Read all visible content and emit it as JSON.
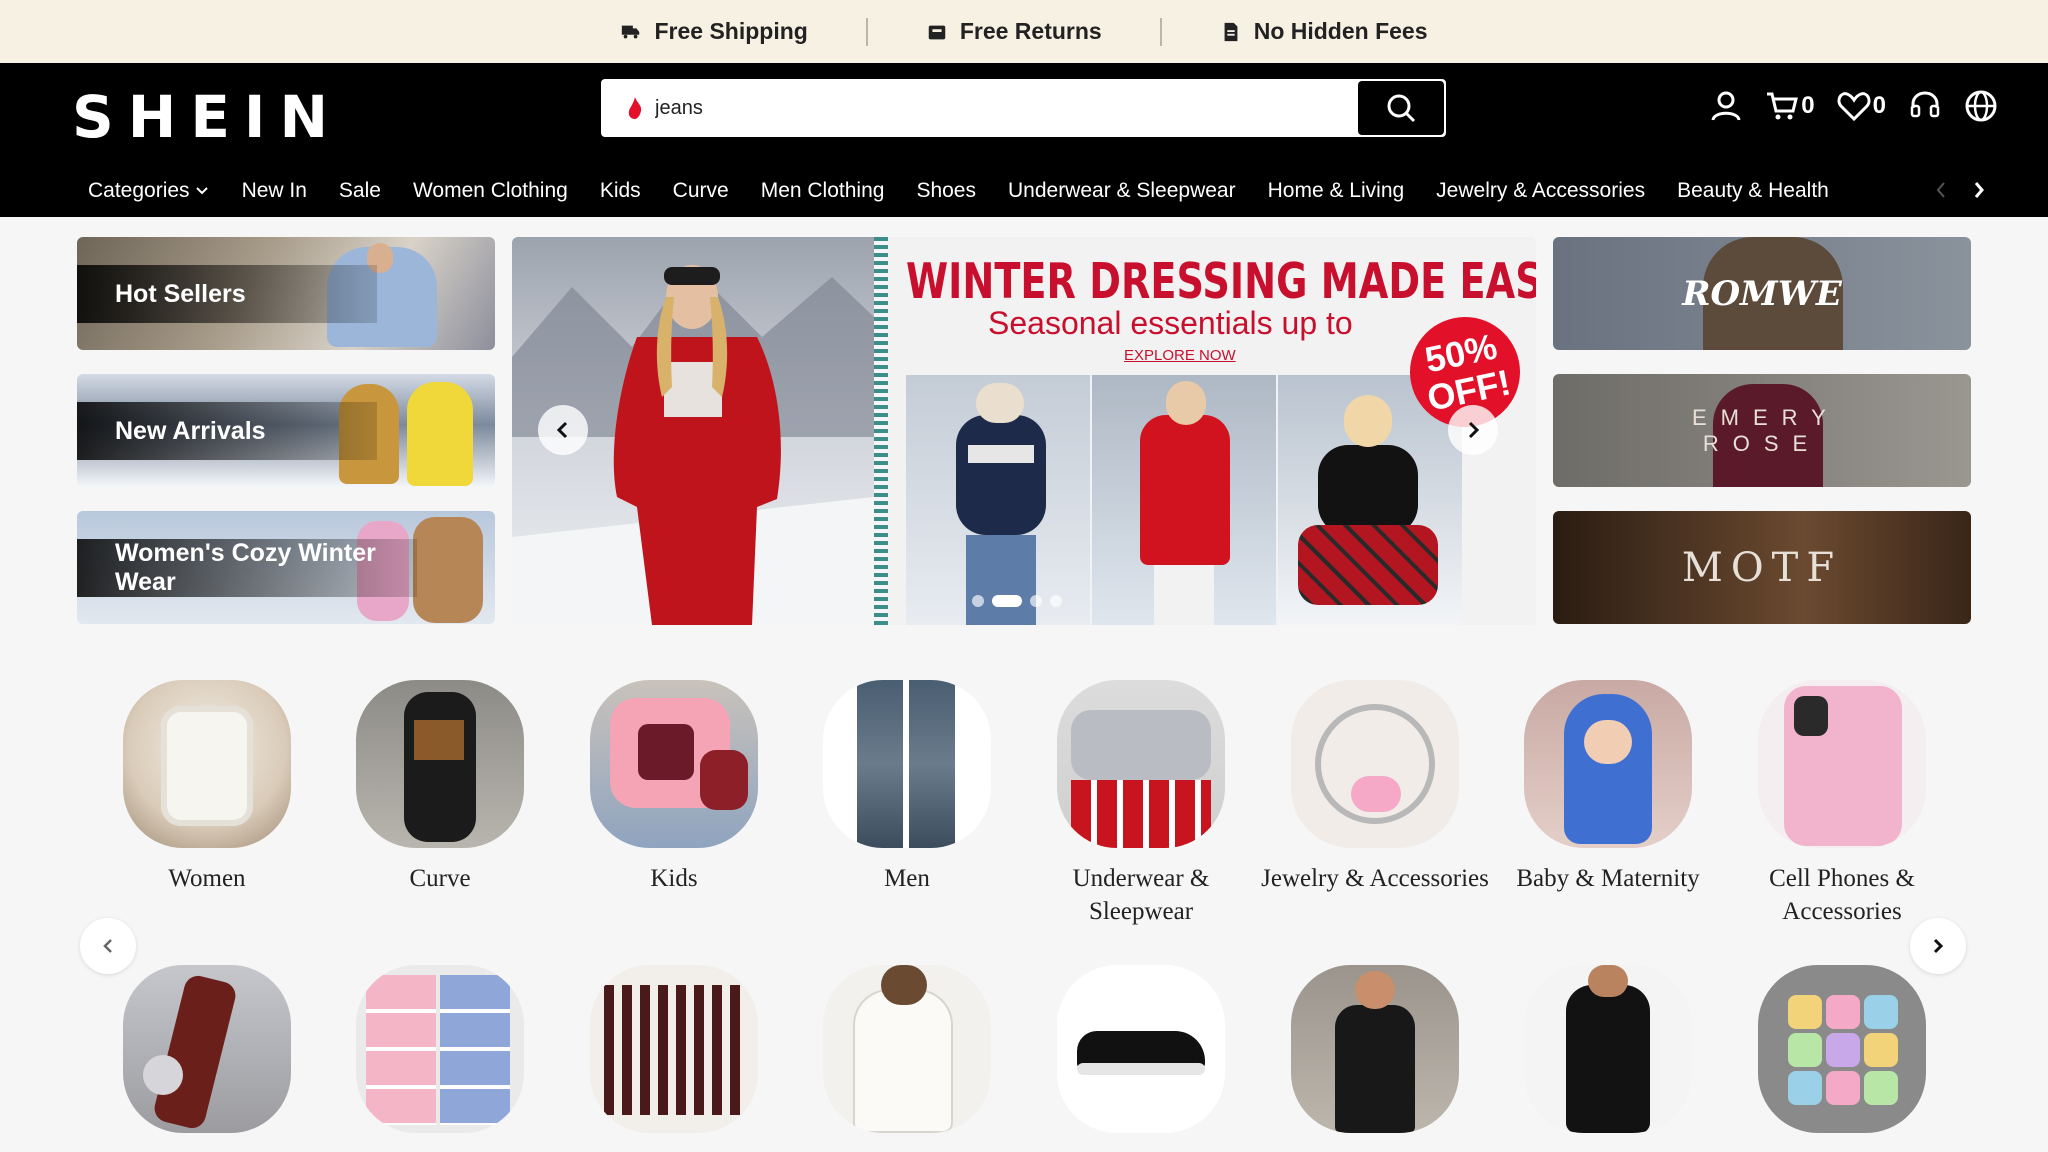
{
  "promo": {
    "items": [
      {
        "icon": "truck-icon",
        "label": "Free Shipping"
      },
      {
        "icon": "box-return-icon",
        "label": "Free Returns"
      },
      {
        "icon": "receipt-icon",
        "label": "No Hidden Fees"
      }
    ]
  },
  "header": {
    "logo": "SHEIN",
    "search_value": "jeans",
    "cart_count": "0",
    "wishlist_count": "0"
  },
  "nav": {
    "items": [
      "Categories",
      "New In",
      "Sale",
      "Women Clothing",
      "Kids",
      "Curve",
      "Men Clothing",
      "Shoes",
      "Underwear & Sleepwear",
      "Home & Living",
      "Jewelry & Accessories",
      "Beauty & Health"
    ]
  },
  "left_tiles": [
    "Hot Sellers",
    "New Arrivals",
    "Women's Cozy Winter Wear"
  ],
  "carousel": {
    "title": "WINTER DRESSING MADE EASY",
    "subtitle": "Seasonal essentials up to",
    "link": "EXPLORE NOW",
    "badge_line1": "50%",
    "badge_line2": "OFF!",
    "slide_count": 4,
    "active_slide": 2
  },
  "brands": [
    "ROMWE",
    "EMERY ROSE",
    "MOTF"
  ],
  "categories_row1": [
    "Women",
    "Curve",
    "Kids",
    "Men",
    "Underwear & Sleepwear",
    "Jewelry & Accessories",
    "Baby & Maternity",
    "Cell Phones & Accessories"
  ],
  "colors": {
    "promo_bg": "#f7f1e4",
    "header_bg": "#000000",
    "accent_red": "#c8102e"
  }
}
